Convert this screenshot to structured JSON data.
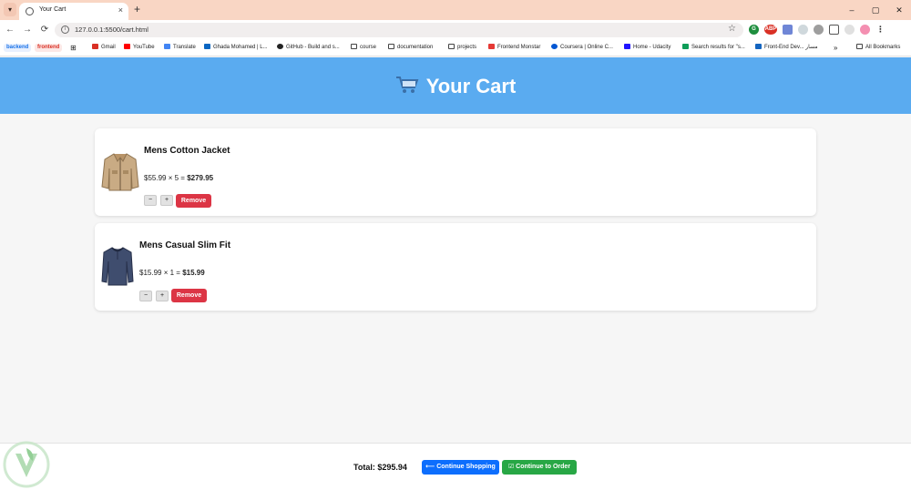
{
  "browser": {
    "tab_title": "Your Cart",
    "tab_close": "×",
    "new_tab": "+",
    "url": "127.0.0.1:5500/cart.html",
    "window_controls": [
      "–",
      "▢",
      "✕"
    ],
    "bookmarks": [
      {
        "label": "backend",
        "kind": "chip",
        "color": "#1a73e8"
      },
      {
        "label": "frontend",
        "kind": "chip",
        "color": "#d93025"
      },
      {
        "label": "Gmail",
        "kind": "link",
        "color": "#d93025"
      },
      {
        "label": "YouTube",
        "kind": "link",
        "color": "#ff0000"
      },
      {
        "label": "Translate",
        "kind": "link",
        "color": "#4285f4"
      },
      {
        "label": "Ghada Mohamed | L...",
        "kind": "link",
        "color": "#0a66c2"
      },
      {
        "label": "GitHub - Build and s...",
        "kind": "link",
        "color": "#222222"
      },
      {
        "label": "course",
        "kind": "folder",
        "color": "#444444"
      },
      {
        "label": "documentation",
        "kind": "folder",
        "color": "#444444"
      },
      {
        "label": "projects",
        "kind": "folder",
        "color": "#444444"
      },
      {
        "label": "Frontend Monstar",
        "kind": "link",
        "color": "#e53935"
      },
      {
        "label": "Coursera | Online C...",
        "kind": "link",
        "color": "#0056d2"
      },
      {
        "label": "Home - Udacity",
        "kind": "link",
        "color": "#2015ff"
      },
      {
        "label": "Search results for \"s...",
        "kind": "link",
        "color": "#0f9d58"
      },
      {
        "label": "Front-End Dev... مسار",
        "kind": "link",
        "color": "#1565c0"
      },
      {
        "label": "»",
        "kind": "more",
        "color": "#222222"
      },
      {
        "label": "All Bookmarks",
        "kind": "folder",
        "color": "#444444"
      }
    ]
  },
  "page": {
    "title": "Your Cart",
    "accent": "#5aabf0"
  },
  "cart": {
    "items": [
      {
        "name": "Mens Cotton Jacket",
        "unit_price": "$55.99",
        "times": "×",
        "quantity": "5",
        "equals": "=",
        "subtotal": "$279.95",
        "minus_label": "−",
        "plus_label": "+",
        "remove_label": "Remove"
      },
      {
        "name": "Mens Casual Slim Fit",
        "unit_price": "$15.99",
        "times": "×",
        "quantity": "1",
        "equals": "=",
        "subtotal": "$15.99",
        "minus_label": "−",
        "plus_label": "+",
        "remove_label": "Remove"
      }
    ]
  },
  "footer": {
    "total_label": "Total:",
    "total_value": "$295.94",
    "continue_label": "⟵ Continue Shopping",
    "order_label": "☑ Continue to Order",
    "continue_color": "#0d6efd",
    "order_color": "#28a745"
  }
}
